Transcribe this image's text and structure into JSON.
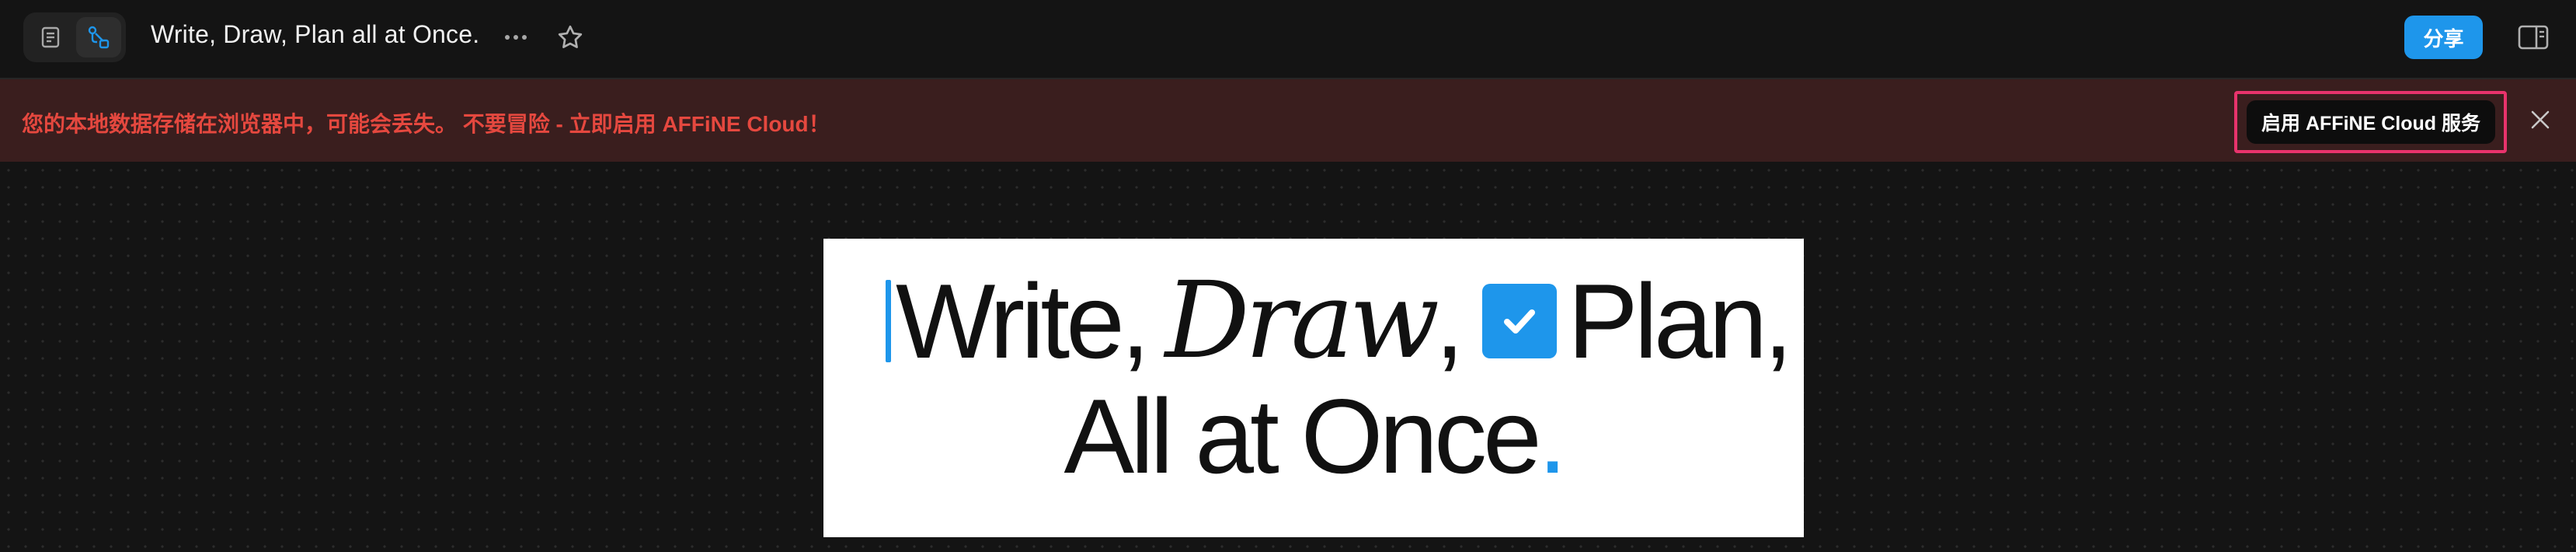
{
  "header": {
    "title": "Write, Draw, Plan all at Once.",
    "share_label": "分享",
    "icons": {
      "page_mode": "page-mode-icon",
      "edgeless_mode": "edgeless-mode-icon",
      "more": "more-horizontal-icon",
      "favorite": "star-icon",
      "sidebar": "right-sidebar-toggle-icon"
    }
  },
  "banner": {
    "message": "您的本地数据存储在浏览器中，可能会丢失。 不要冒险 - 立即启用 AFFiNE Cloud！",
    "button_label": "启用 AFFiNE Cloud 服务"
  },
  "hero": {
    "line1_a": "Write,",
    "line1_b": "Draw",
    "line1_c": ",",
    "line1_d": "Plan,",
    "line2": "All at Once",
    "line2_dot": "."
  },
  "colors": {
    "accent": "#1e96eb",
    "banner_bg": "#3a1e1e",
    "banner_text": "#e5483f",
    "highlight_outline": "#e8336c"
  }
}
